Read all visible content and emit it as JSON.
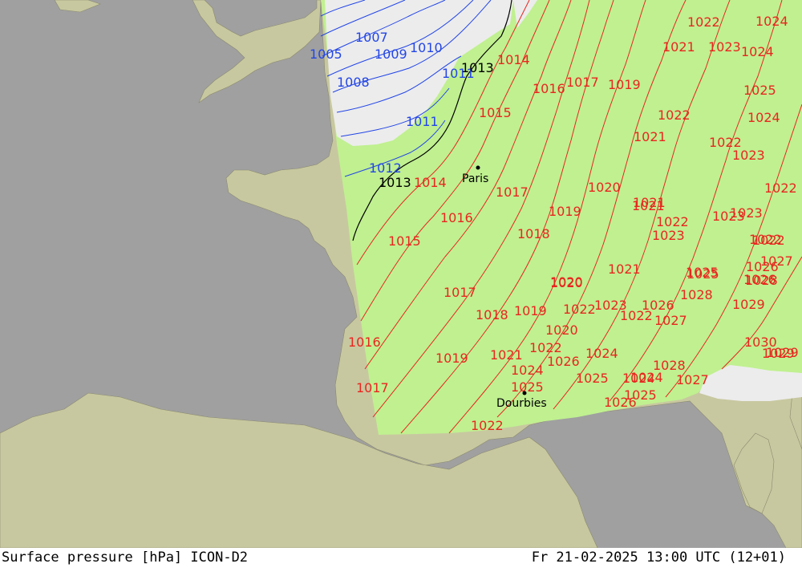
{
  "footer": {
    "left_text": "Surface pressure [hPa] ICON-D2",
    "right_text": "Fr 21-02-2025 13:00 UTC (12+01)"
  },
  "colors": {
    "sea": "#a0a0a0",
    "land": "#c8c8a0",
    "model_domain": "#c0f090",
    "cloud_area": "#ececec",
    "isobar_high": "#e8261f",
    "isobar_low": "#2346e6",
    "isobar_ref": "#000000"
  },
  "cities": [
    {
      "name": "Paris",
      "id": "paris"
    },
    {
      "name": "Dourbies",
      "id": "dourbies"
    }
  ],
  "isobar_labels": {
    "blue": [
      "1007",
      "1005",
      "1009",
      "1010",
      "1008",
      "1011",
      "1011",
      "1012"
    ],
    "black": [
      "1013",
      "1013"
    ],
    "red": [
      "1014",
      "1014",
      "1015",
      "1016",
      "1017",
      "1017",
      "1016",
      "1018",
      "1019",
      "1020",
      "1015",
      "1016",
      "1017",
      "1017",
      "1018",
      "1019",
      "1020",
      "1021",
      "1022",
      "1021",
      "1019",
      "1022",
      "1023",
      "1024",
      "1025",
      "1024",
      "1022",
      "1021",
      "1022",
      "1023",
      "1024",
      "1025",
      "1026",
      "1027",
      "1028",
      "1029",
      "1030",
      "1029",
      "1022",
      "1023",
      "1022",
      "1021",
      "1020",
      "1022",
      "1023",
      "1024",
      "1025",
      "1022",
      "1021",
      "1022",
      "1026",
      "1023",
      "1024",
      "1028",
      "1027",
      "1026",
      "1025",
      "1024",
      "1025",
      "1026",
      "1019",
      "1022",
      "1029",
      "1028",
      "1027",
      "1026",
      "1025",
      "1024",
      "1023",
      "1022",
      "1021",
      "1020"
    ]
  }
}
